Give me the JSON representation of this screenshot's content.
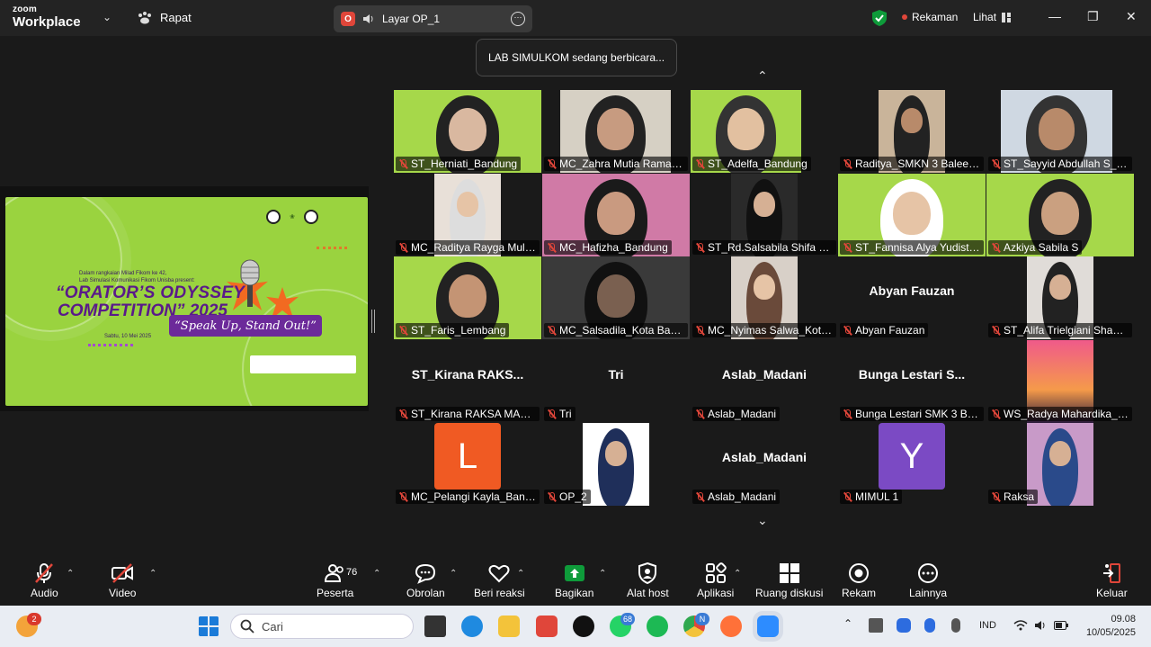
{
  "titlebar": {
    "brand_top": "zoom",
    "brand_bottom": "Workplace",
    "meeting_menu": "Rapat",
    "share_label": "Layar OP_1",
    "recording_label": "Rekaman",
    "view_label": "Lihat"
  },
  "toast": "LAB SIMULKOM sedang berbicara...",
  "slide": {
    "intro_line1": "Dalam rangkaian Milad Fikom ke 42,",
    "intro_line2": "Lab Simulasi Komunikasi Fikom Unisba present:",
    "title_line1": "“ORATOR’S ODYSSEY",
    "title_line2": "COMPETITION” 2025",
    "tagline": "“Speak Up, Stand Out!”",
    "date": "Sabtu, 10 Mei 2025"
  },
  "participants": [
    {
      "label": "ST_Herniati_Bandung",
      "muted": true
    },
    {
      "label": "MC_Zahra Mutia Ramad...",
      "muted": true
    },
    {
      "label": "ST_Adelfa_Bandung",
      "muted": true
    },
    {
      "label": "Raditya_SMKN 3 Baleen...",
      "muted": true
    },
    {
      "label": "ST_Sayyid Abdullah S_K...",
      "muted": true
    },
    {
      "label": "MC_Raditya Rayga Mula...",
      "muted": true
    },
    {
      "label": "MC_Hafizha_Bandung",
      "muted": true
    },
    {
      "label": "ST_Rd.Salsabila Shifa K.H",
      "muted": true
    },
    {
      "label": "ST_Fannisa Alya Yudisti_...",
      "muted": true
    },
    {
      "label": "Azkiya Sabila S",
      "muted": true
    },
    {
      "label": "ST_Faris_Lembang",
      "muted": true
    },
    {
      "label": "MC_Salsadila_Kota Band...",
      "muted": true
    },
    {
      "label": "MC_Nyimas Salwa_Kota ...",
      "muted": true
    },
    {
      "label": "Abyan  Fauzan",
      "muted": true,
      "big_name": "Abyan  Fauzan"
    },
    {
      "label": "ST_Alifa Trielgiani Shahi...",
      "muted": true
    },
    {
      "label": "ST_Kirana RAKSA MAHA...",
      "muted": true,
      "big_name": "ST_Kirana  RAKS..."
    },
    {
      "label": "Tri",
      "muted": true,
      "big_name": "Tri"
    },
    {
      "label": "Aslab_Madani",
      "muted": true,
      "big_name": "Aslab_Madani"
    },
    {
      "label": "Bunga Lestari SMK 3 BA...",
      "muted": true,
      "big_name": "Bunga Lestari S..."
    },
    {
      "label": "WS_Radya Mahardika_K...",
      "muted": true
    },
    {
      "label": "MC_Pelangi Kayla_Band...",
      "muted": true,
      "avatar_letter": "L"
    },
    {
      "label": "OP_2",
      "muted": true
    },
    {
      "label": "Aslab_Madani",
      "muted": true,
      "big_name": "Aslab_Madani"
    },
    {
      "label": "MIMUL 1",
      "muted": true,
      "avatar_letter": "Y"
    },
    {
      "label": "Raksa",
      "muted": true
    }
  ],
  "toolbar": {
    "audio": "Audio",
    "video": "Video",
    "participants": "Peserta",
    "participants_count": "76",
    "chat": "Obrolan",
    "reactions": "Beri reaksi",
    "share": "Bagikan",
    "host_tools": "Alat host",
    "apps": "Aplikasi",
    "rooms": "Ruang diskusi",
    "record": "Rekam",
    "more": "Lainnya",
    "leave": "Keluar"
  },
  "taskbar": {
    "search_placeholder": "Cari",
    "weather_badge": "2",
    "whatsapp_badge": "68",
    "chrome_badge": "N",
    "language": "IND",
    "time": "09.08",
    "date": "10/05/2025"
  },
  "colors": {
    "accent_green": "#0e9b3a",
    "recording_red": "#e0463a",
    "slide_green": "#9ad33f",
    "slide_purple": "#6c2a9a"
  }
}
